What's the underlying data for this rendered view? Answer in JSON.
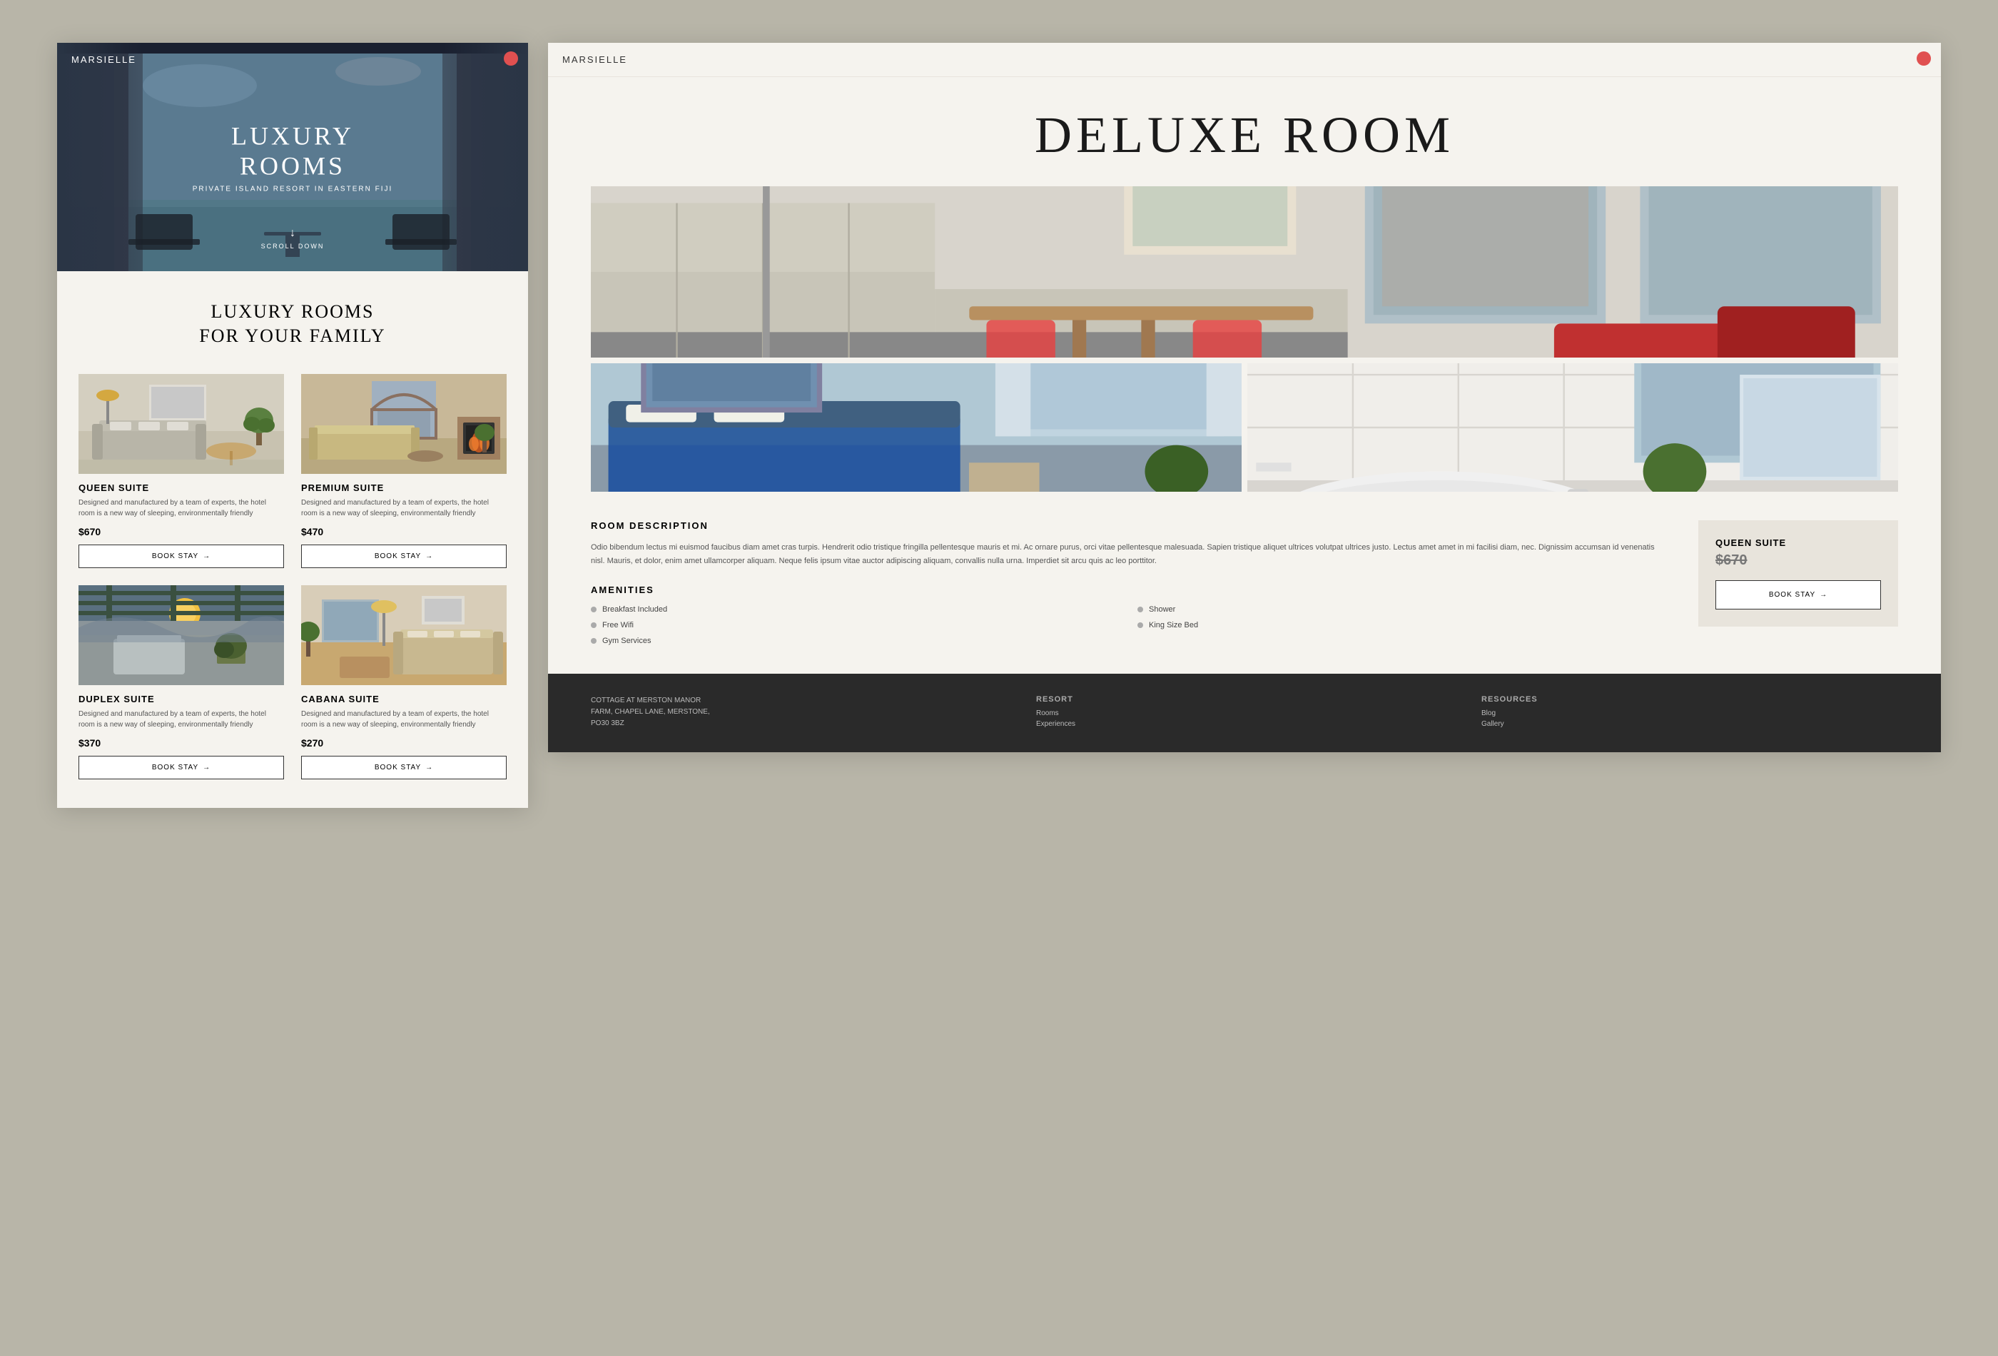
{
  "left": {
    "logo": "MARSIELLE",
    "hero": {
      "title": "LUXURY ROOMS",
      "subtitle": "PRIVATE ISLAND RESORT IN EASTERN FIJI",
      "scroll_text": "SCROLL DOWN"
    },
    "section": {
      "title_line1": "LUXURY ROOMS",
      "title_line2": "FOR YOUR FAMILY"
    },
    "rooms": [
      {
        "id": "queen",
        "name": "QUEEN SUITE",
        "description": "Designed and manufactured by a team of experts, the hotel room is a new way of sleeping, environmentally friendly",
        "price": "$670",
        "btn": "BOOK STAY"
      },
      {
        "id": "premium",
        "name": "PREMIUM SUITE",
        "description": "Designed and manufactured by a team of experts, the hotel room is a new way of sleeping, environmentally friendly",
        "price": "$470",
        "btn": "BOOK STAY"
      },
      {
        "id": "duplex",
        "name": "DUPLEX SUITE",
        "description": "Designed and manufactured by a team of experts, the hotel room is a new way of sleeping, environmentally friendly",
        "price": "$370",
        "btn": "BOOK STAY"
      },
      {
        "id": "cabana",
        "name": "CABANA SUITE",
        "description": "Designed and manufactured by a team of experts, the hotel room is a new way of sleeping, environmentally friendly",
        "price": "$270",
        "btn": "BOOK STAY"
      }
    ]
  },
  "right": {
    "logo": "MARSIELLE",
    "title": "DELUXE ROOM",
    "description": {
      "heading": "ROOM DESCRIPTION",
      "text": "Odio bibendum lectus mi euismod faucibus diam amet cras turpis. Hendrerit odio tristique fringilla pellentesque mauris et mi. Ac ornare purus, orci vitae pellentesque malesuada. Sapien tristique aliquet ultrices volutpat ultrices justo. Lectus amet amet in mi facilisi diam, nec. Dignissim accumsan id venenatis nisl. Mauris, et dolor, enim amet ullamcorper aliquam. Neque felis ipsum vitae auctor adipiscing aliquam, convallis nulla urna. Imperdiet sit arcu quis ac leo porttitor."
    },
    "amenities": {
      "heading": "AMENITIES",
      "items": [
        {
          "label": "Breakfast Included"
        },
        {
          "label": "Shower"
        },
        {
          "label": "Free Wifi"
        },
        {
          "label": "King Size Bed"
        },
        {
          "label": "Gym Services"
        }
      ]
    },
    "booking": {
      "suite_name": "QUEEN SUITE",
      "price": "$670",
      "btn": "BOOK STAY"
    },
    "footer": {
      "address": {
        "heading": "COTTAGE AT MERSTON MANOR FARM, CHAPEL LANE, MERSTONE, PO30 3BZ",
        "lines": [
          "COTTAGE AT MERSTON MANOR",
          "FARM, CHAPEL LANE, MERSTONE,",
          "PO30 3BZ"
        ]
      },
      "resort": {
        "heading": "RESORT",
        "items": [
          "Rooms",
          "Experiences"
        ]
      },
      "resources": {
        "heading": "RESOURCES",
        "items": [
          "Blog",
          "Gallery"
        ]
      }
    }
  },
  "colors": {
    "accent_red": "#e05050",
    "dark_bg": "#2a2a2a",
    "light_bg": "#f5f3ee",
    "page_bg": "#b8b5a8"
  }
}
